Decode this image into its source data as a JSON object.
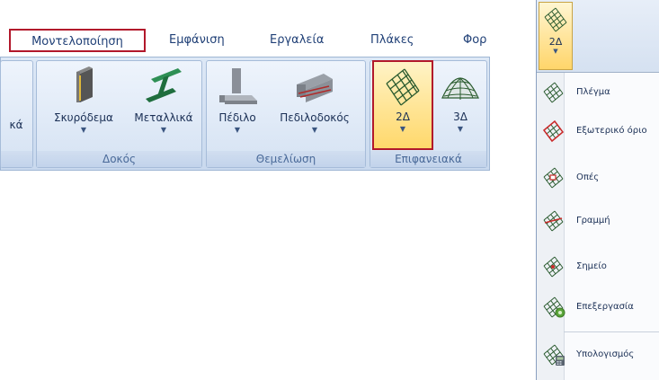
{
  "ribbon": {
    "tabs": [
      "Μοντελοποίηση",
      "Εμφάνιση",
      "Εργαλεία",
      "Πλάκες",
      "Φορ"
    ],
    "active_tab": "Μοντελοποίηση",
    "groups": [
      {
        "label": "",
        "buttons": [
          {
            "label": "κά"
          }
        ]
      },
      {
        "label": "Δοκός",
        "buttons": [
          {
            "label": "Σκυρόδεμα"
          },
          {
            "label": "Μεταλλικά"
          }
        ]
      },
      {
        "label": "Θεμελίωση",
        "buttons": [
          {
            "label": "Πέδιλο"
          },
          {
            "label": "Πεδιλοδοκός"
          }
        ]
      },
      {
        "label": "Επιφανειακά",
        "buttons": [
          {
            "label": "2Δ"
          },
          {
            "label": "3Δ"
          }
        ]
      }
    ],
    "highlight_color": "#b2182b"
  },
  "dropdown": {
    "button_label": "2Δ",
    "items": [
      {
        "label": "Πλέγμα",
        "icon": "mesh-icon"
      },
      {
        "label": "Εξωτερικό όριο",
        "icon": "outer-boundary-icon"
      },
      {
        "label": "Οπές",
        "icon": "holes-icon"
      },
      {
        "label": "Γραμμή",
        "icon": "line-icon"
      },
      {
        "label": "Σημείο",
        "icon": "point-icon"
      },
      {
        "label": "Επεξεργασία",
        "icon": "edit-mesh-icon"
      },
      {
        "label": "Υπολογισμός",
        "icon": "calculate-icon"
      }
    ]
  }
}
